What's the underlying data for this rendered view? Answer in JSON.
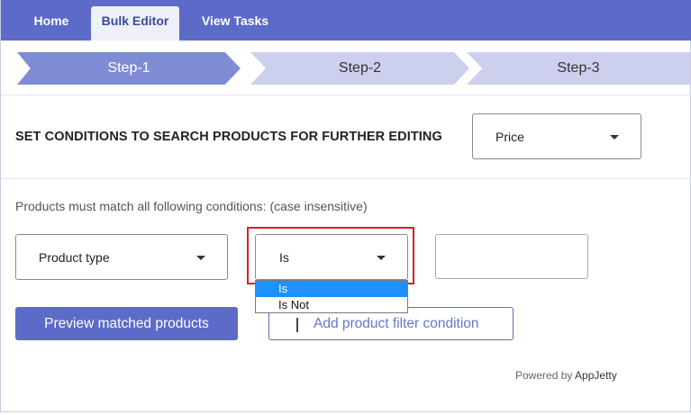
{
  "nav": {
    "tabs": [
      {
        "label": "Home",
        "active": false
      },
      {
        "label": "Bulk Editor",
        "active": true
      },
      {
        "label": "View Tasks",
        "active": false
      }
    ]
  },
  "steps": [
    {
      "label": "Step-1",
      "active": true
    },
    {
      "label": "Step-2",
      "active": false
    },
    {
      "label": "Step-3",
      "active": false
    }
  ],
  "search": {
    "title": "SET CONDITIONS TO SEARCH PRODUCTS FOR FURTHER EDITING",
    "field_select": {
      "value": "Price"
    }
  },
  "conditions": {
    "label": "Products must match all following conditions: (case insensitive)",
    "field_select": {
      "value": "Product type"
    },
    "operator_select": {
      "value": "Is",
      "open": true,
      "options": [
        "Is",
        "Is Not"
      ],
      "highlighted_option": "Is"
    },
    "value_input": {
      "value": "",
      "placeholder": ""
    }
  },
  "actions": {
    "preview_label": "Preview matched products",
    "add_condition_label": "Add product filter condition"
  },
  "footer": {
    "prefix": "Powered by",
    "brand": "AppJetty"
  },
  "colors": {
    "primary": "#5c6bc8",
    "step_active": "#7f8bd4",
    "step_inactive": "#ccd0ee",
    "highlight_border": "#d6212a",
    "option_selected": "#1e90ff"
  },
  "icons": {
    "dropdown_caret": "caret-down-icon",
    "add": "plus-icon"
  }
}
